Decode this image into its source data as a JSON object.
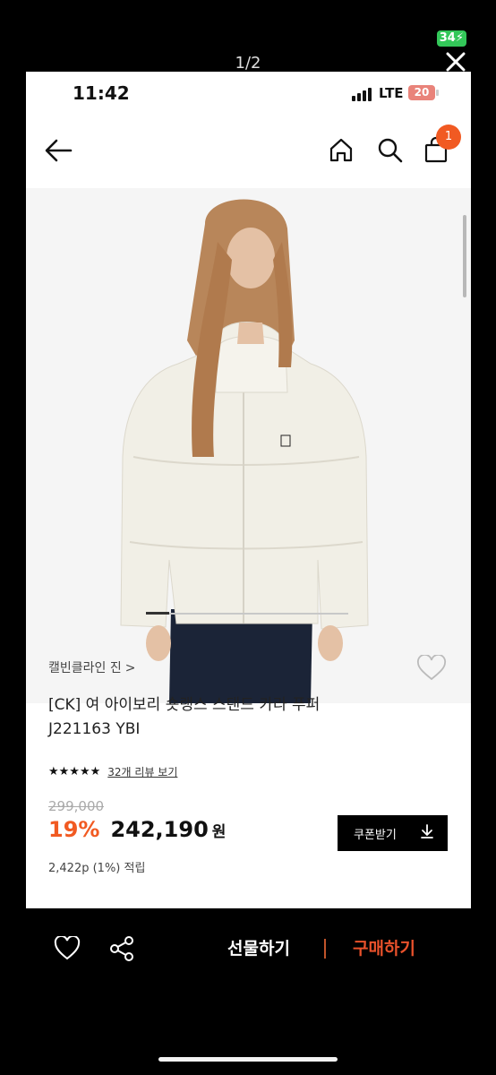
{
  "viewer": {
    "battery_label": "34",
    "counter": "1/2"
  },
  "status_bar": {
    "time": "11:42",
    "network": "LTE",
    "battery": "20"
  },
  "header": {
    "cart_count": "1"
  },
  "product": {
    "brand": "캘빈클라인 진",
    "brand_chevron": ">",
    "title_line1": "[CK] 여 아이보리 숏랭스 스탠드 카라 푸퍼",
    "title_line2": "J221163 YBI",
    "stars": "★★★★★",
    "review_link": "32개 리뷰 보기",
    "rating_fraction": 1.0,
    "original_price": "299,000",
    "discount": "19%",
    "price": "242,190",
    "currency": "원",
    "points": "2,422p (1%) 적립",
    "coupon_label": "쿠폰받기"
  },
  "bottom_bar": {
    "gift_label": "선물하기",
    "buy_label": "구매하기"
  },
  "colors": {
    "accent": "#f15a22",
    "buy": "#e8512b",
    "battery_green": "#33c759",
    "status_battery": "#e9837a"
  },
  "icons": [
    "back-arrow-icon",
    "home-icon",
    "search-icon",
    "shopping-bag-icon",
    "heart-icon",
    "share-icon",
    "download-icon",
    "close-icon"
  ]
}
